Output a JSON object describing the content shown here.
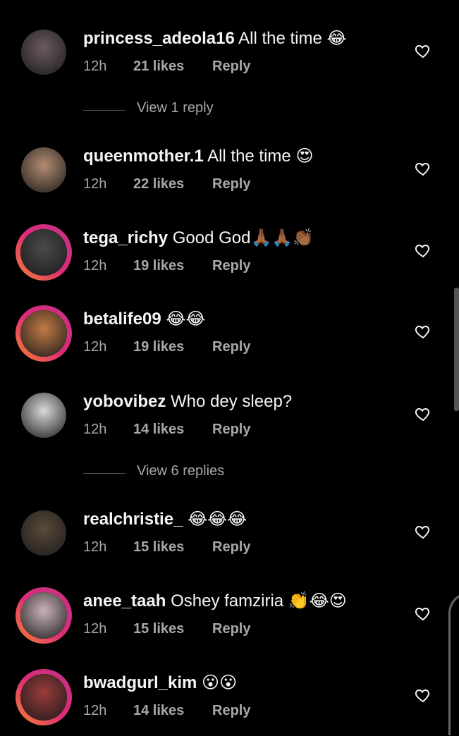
{
  "comments": [
    {
      "username": "princess_adeola16",
      "text": "All the time",
      "emoji": "😂",
      "time": "12h",
      "likes": "21 likes",
      "reply": "Reply",
      "ring": false,
      "avatar_color": "#6b5a63"
    },
    {
      "username": "queenmother.1",
      "text": "All the time",
      "emoji": "😍",
      "time": "12h",
      "likes": "22 likes",
      "reply": "Reply",
      "ring": false,
      "avatar_color": "#b48d72"
    },
    {
      "username": "tega_richy",
      "text": "Good God",
      "emoji": "🙏🏾🙏🏾👏🏾",
      "time": "12h",
      "likes": "19 likes",
      "reply": "Reply",
      "ring": true,
      "avatar_color": "#4a4a4a"
    },
    {
      "username": "betalife09",
      "text": "",
      "emoji": "😂😂",
      "time": "12h",
      "likes": "19 likes",
      "reply": "Reply",
      "ring": true,
      "avatar_color": "#c27a45"
    },
    {
      "username": "yobovibez",
      "text": "Who dey sleep?",
      "emoji": "",
      "time": "12h",
      "likes": "14 likes",
      "reply": "Reply",
      "ring": false,
      "avatar_color": "#d9d9d9"
    },
    {
      "username": "realchristie_",
      "text": "",
      "emoji": "😂😂😂",
      "time": "12h",
      "likes": "15 likes",
      "reply": "Reply",
      "ring": false,
      "avatar_color": "#5b4a3a"
    },
    {
      "username": "anee_taah",
      "text": "Oshey famziria",
      "emoji": "👏😂😍",
      "time": "12h",
      "likes": "15 likes",
      "reply": "Reply",
      "ring": true,
      "avatar_color": "#c9b2b8"
    },
    {
      "username": "bwadgurl_kim",
      "text": "",
      "emoji": "😮😮",
      "time": "12h",
      "likes": "14 likes",
      "reply": "Reply",
      "ring": true,
      "avatar_color": "#9b3b3b"
    }
  ],
  "view_replies": [
    "View 1 reply",
    "View 6 replies"
  ],
  "colors": {
    "background": "#000000",
    "text": "#f5f5f5",
    "muted": "#a8a8a8"
  }
}
